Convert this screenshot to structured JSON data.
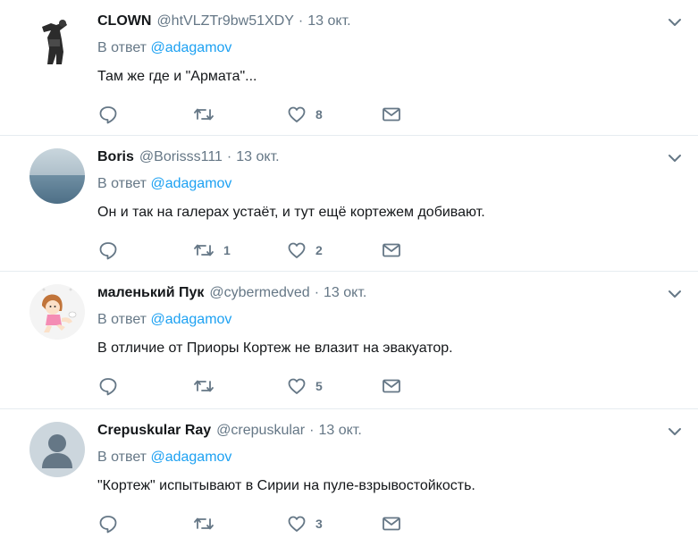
{
  "feed": {
    "tweets": [
      {
        "name": "CLOWN",
        "handle": "@htVLZTr9bw51XDY",
        "separator": "·",
        "date": "13 окт.",
        "reply_prefix": "В ответ",
        "reply_mention": "@adagamov",
        "text": "Там же где и \"Армата\"...",
        "retweets": "",
        "likes": "8",
        "avatar": "figure-silhouette"
      },
      {
        "name": "Boris",
        "handle": "@Borisss111",
        "separator": "·",
        "date": "13 окт.",
        "reply_prefix": "В ответ",
        "reply_mention": "@adagamov",
        "text": "Он и так на галерах устаёт, и тут ещё кортежем добивают.",
        "retweets": "1",
        "likes": "2",
        "avatar": "sea-horizon"
      },
      {
        "name": "маленький Пук",
        "handle": "@cybermedved",
        "separator": "·",
        "date": "13 окт.",
        "reply_prefix": "В ответ",
        "reply_mention": "@adagamov",
        "text": "В отличие от Приоры Кортеж не влазит на эвакуатор.",
        "retweets": "",
        "likes": "5",
        "avatar": "cartoon-girl"
      },
      {
        "name": "Crepuskular Ray",
        "handle": "@crepuskular",
        "separator": "·",
        "date": "13 окт.",
        "reply_prefix": "В ответ",
        "reply_mention": "@adagamov",
        "text": "\"Кортеж\" испытывают в Сирии на пуле-взрывостойкость.",
        "retweets": "",
        "likes": "3",
        "avatar": "default-egg"
      }
    ]
  },
  "colors": {
    "text": "#14171a",
    "muted": "#657786",
    "link": "#1da1f2",
    "divider": "#e6ecf0"
  },
  "icons": [
    "reply-icon",
    "retweet-icon",
    "heart-icon",
    "envelope-icon",
    "chevron-down-icon"
  ]
}
